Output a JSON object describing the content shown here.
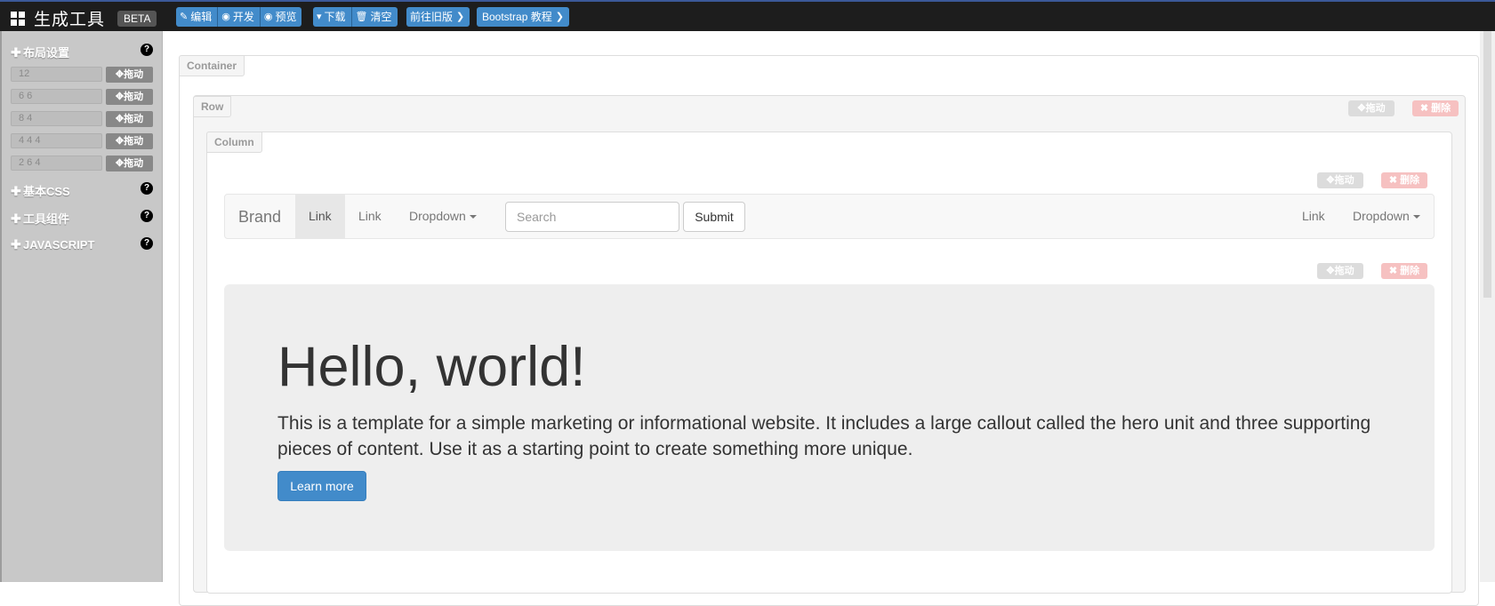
{
  "app": {
    "title": "生成工具",
    "badge": "BETA"
  },
  "toolbar": {
    "edit": "编辑",
    "develop": "开发",
    "preview": "预览",
    "download": "下载",
    "clear": "清空",
    "old_version": "前往旧版",
    "tutorial": "Bootstrap 教程"
  },
  "sidebar": {
    "layout_title": "布局设置",
    "layout_rows": [
      {
        "value": "12",
        "drag": "拖动"
      },
      {
        "value": "6 6",
        "drag": "拖动"
      },
      {
        "value": "8 4",
        "drag": "拖动"
      },
      {
        "value": "4 4 4",
        "drag": "拖动"
      },
      {
        "value": "2 6 4",
        "drag": "拖动"
      }
    ],
    "css_title": "基本CSS",
    "components_title": "工具组件",
    "js_title": "JAVASCRIPT",
    "help": "?"
  },
  "canvas": {
    "container_label": "Container",
    "row_label": "Row",
    "column_label": "Column",
    "drag": "拖动",
    "delete": "删除"
  },
  "navbar": {
    "brand": "Brand",
    "link_active": "Link",
    "link2": "Link",
    "dropdown": "Dropdown",
    "search_placeholder": "Search",
    "submit": "Submit",
    "right_link": "Link",
    "right_dropdown": "Dropdown"
  },
  "jumbotron": {
    "heading": "Hello, world!",
    "text": "This is a template for a simple marketing or informational website. It includes a large callout called the hero unit and three supporting pieces of content. Use it as a starting point to create something more unique.",
    "button": "Learn more"
  },
  "colors": {
    "topbar": "#1d1d1d",
    "primary": "#428bca",
    "sidebar": "#c8c8c8",
    "jumbotron": "#eeeeee"
  }
}
